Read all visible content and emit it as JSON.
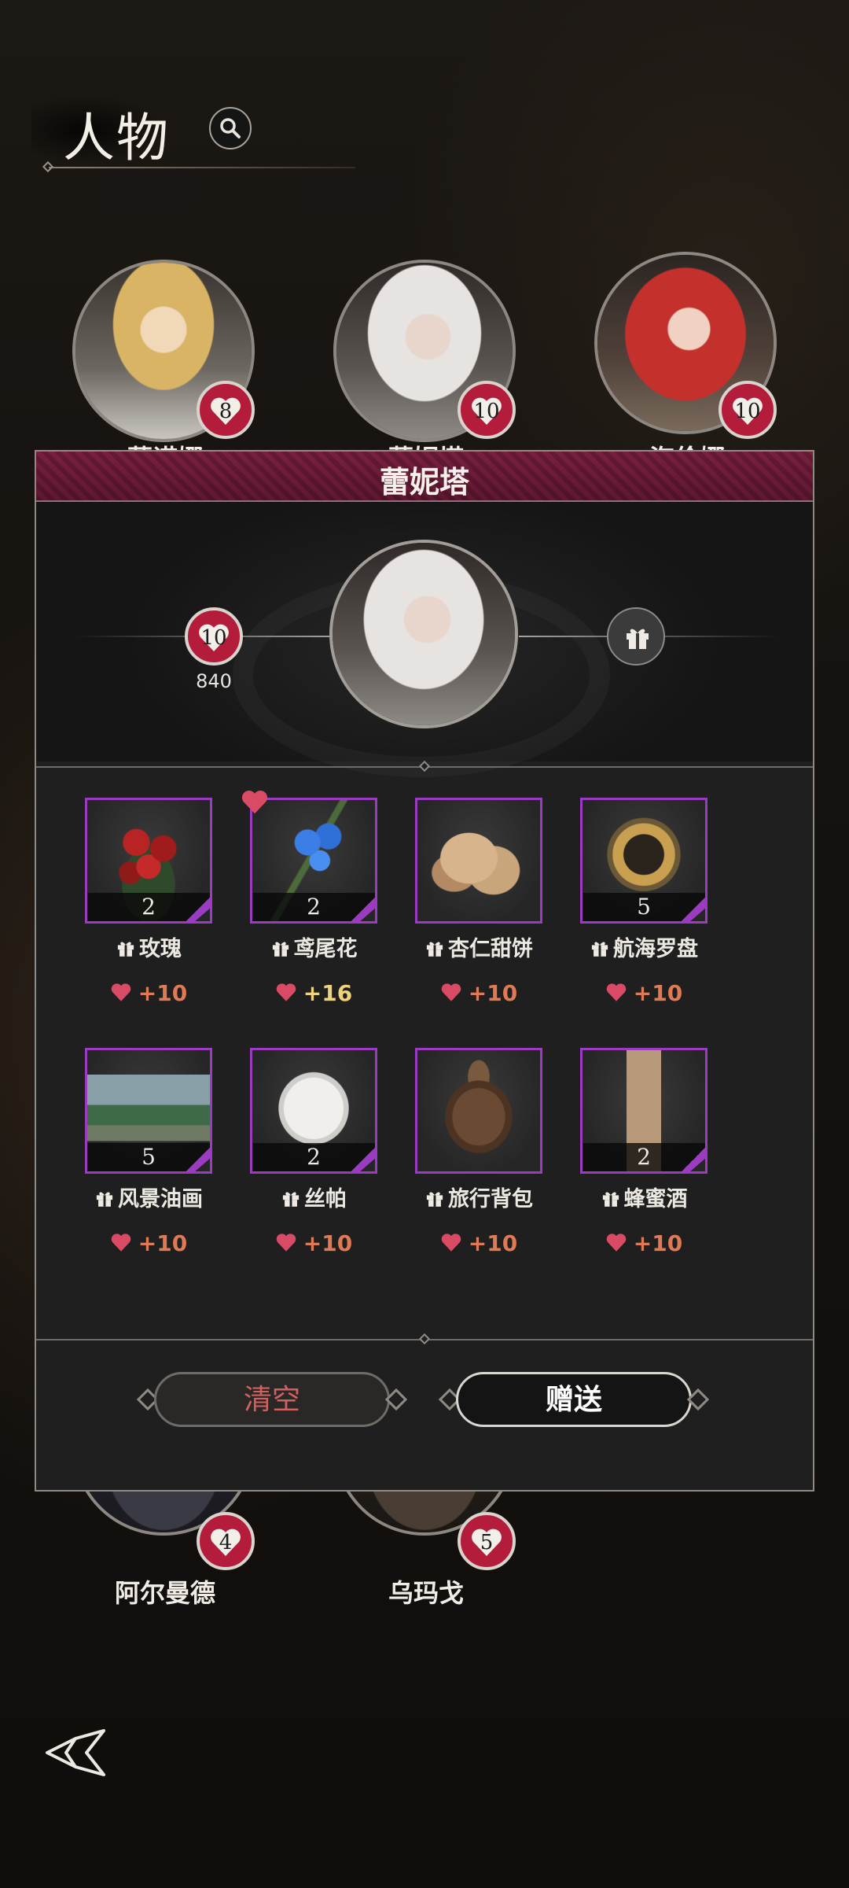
{
  "header": {
    "title": "人物"
  },
  "characters": [
    {
      "name": "蕾诺娜",
      "affinity": "8"
    },
    {
      "name": "蕾妮塔",
      "affinity": "10"
    },
    {
      "name": "海伦娜",
      "affinity": "10"
    },
    {
      "name": "阿尔曼德",
      "affinity": "4"
    },
    {
      "name": "乌玛戈",
      "affinity": "5"
    }
  ],
  "modal": {
    "title": "蕾妮塔",
    "affinity_level": "10",
    "affinity_points": "840"
  },
  "gifts": [
    {
      "name": "玫瑰",
      "qty": "2",
      "bonus": "+10",
      "favorite": false
    },
    {
      "name": "鸢尾花",
      "qty": "2",
      "bonus": "+16",
      "favorite": true
    },
    {
      "name": "杏仁甜饼",
      "qty": "",
      "bonus": "+10",
      "favorite": false
    },
    {
      "name": "航海罗盘",
      "qty": "5",
      "bonus": "+10",
      "favorite": false
    },
    {
      "name": "风景油画",
      "qty": "5",
      "bonus": "+10",
      "favorite": false
    },
    {
      "name": "丝帕",
      "qty": "2",
      "bonus": "+10",
      "favorite": false
    },
    {
      "name": "旅行背包",
      "qty": "",
      "bonus": "+10",
      "favorite": false
    },
    {
      "name": "蜂蜜酒",
      "qty": "2",
      "bonus": "+10",
      "favorite": false
    }
  ],
  "buttons": {
    "clear": "清空",
    "give": "赠送"
  },
  "colors": {
    "accent_purple": "#9b3bc2",
    "heart_red": "#b31c3b",
    "title_bar": "#6b1b38",
    "bonus_normal": "#e07a55",
    "bonus_favorite": "#f0d27a"
  },
  "icons": [
    "search-icon",
    "heart-icon",
    "gift-icon",
    "back-icon"
  ]
}
